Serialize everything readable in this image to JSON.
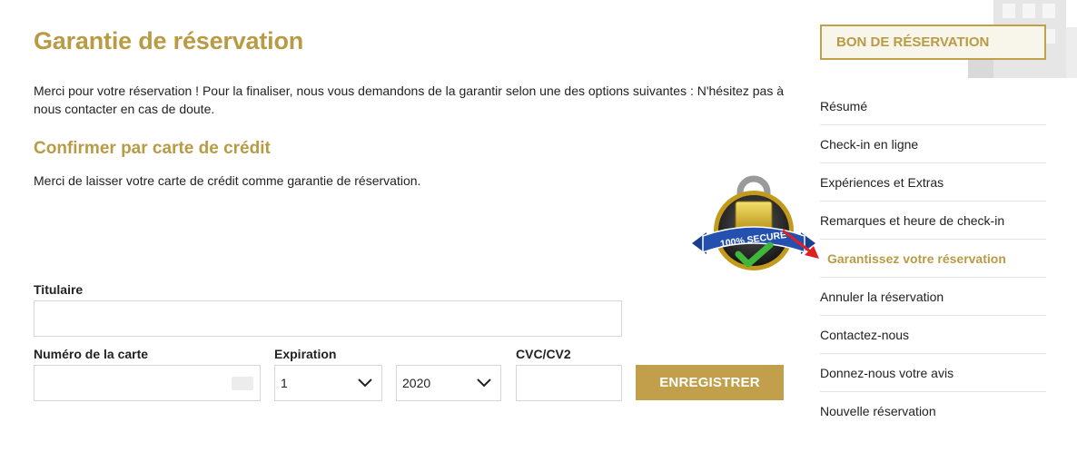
{
  "main": {
    "title": "Garantie de réservation",
    "intro": "Merci pour votre réservation ! Pour la finaliser, nous vous demandons de la garantir selon une des options suivantes : N'hésitez pas à nous contacter en cas de doute.",
    "section_title": "Confirmer par carte de crédit",
    "section_text": "Merci de laisser votre carte de crédit comme garantie de réservation.",
    "badge": {
      "text": "100% SECURE",
      "icon": "padlock-check-icon"
    }
  },
  "form": {
    "holder_label": "Titulaire",
    "holder_value": "",
    "card_number_label": "Numéro de la carte",
    "card_number_value": "",
    "expiration_label": "Expiration",
    "exp_month_value": "1",
    "exp_year_value": "2020",
    "cvc_label": "CVC/CV2",
    "cvc_value": "",
    "save_label": "ENREGISTRER"
  },
  "sidebar": {
    "heading": "BON DE RÉSERVATION",
    "items": [
      {
        "label": "Résumé"
      },
      {
        "label": "Check-in en ligne"
      },
      {
        "label": "Expériences et Extras"
      },
      {
        "label": "Remarques et heure de check-in"
      },
      {
        "label": "Garantissez votre réservation",
        "active": true
      },
      {
        "label": "Annuler la réservation"
      },
      {
        "label": "Contactez-nous"
      },
      {
        "label": "Donnez-nous votre avis"
      },
      {
        "label": "Nouvelle réservation"
      }
    ]
  },
  "colors": {
    "accent": "#c19f4b",
    "accent_text": "#b99b45",
    "pointer_arrow": "#e02020"
  }
}
